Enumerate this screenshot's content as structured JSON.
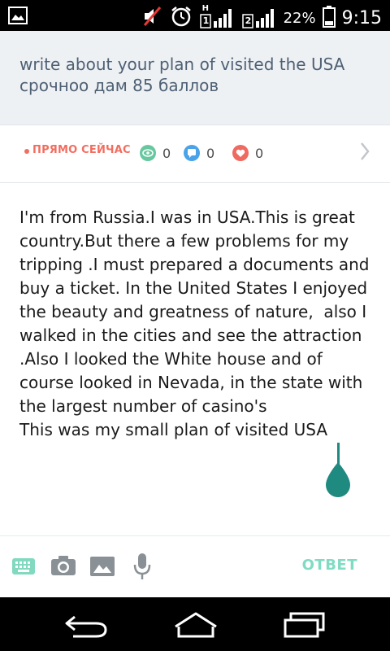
{
  "status_bar": {
    "battery_percent": "22%",
    "time": "9:15",
    "network_label_sim1": "H",
    "sim1_label": "1",
    "sim2_label": "2",
    "icons": [
      "image-notification-icon",
      "muted-speaker-icon",
      "alarm-icon",
      "signal-icon",
      "signal-icon",
      "battery-icon"
    ]
  },
  "question": {
    "text": "write about your plan of visited the USA срочноо дам 85 баллов"
  },
  "live_bar": {
    "label": "ПРЯМО СЕЙЧАС",
    "views_count": "0",
    "comments_count": "0",
    "likes_count": "0",
    "colors": {
      "live": "#f26d5f",
      "views": "#67c79f",
      "comments": "#4aa3e8",
      "likes": "#ef6a60"
    }
  },
  "answer": {
    "text": "I'm from Russia.I was in USA.This is great country.But there a few problems for my tripping .I must prepared a documents and buy a ticket. In the United States I enjoyed the beauty and greatness of nature,  also I walked in the cities and see the attraction .Also I looked the White house and of course looked in Nevada, in the state with the largest number of casino's\nThis was my small plan of visited USA"
  },
  "toolbar": {
    "answer_button_label": "ОТВЕТ",
    "icons": [
      "keyboard-icon",
      "camera-icon",
      "image-icon",
      "microphone-icon"
    ],
    "accent_color": "#7fdcc2"
  },
  "nav_bar": {
    "icons": [
      "back-icon",
      "home-icon",
      "recent-apps-icon"
    ]
  }
}
